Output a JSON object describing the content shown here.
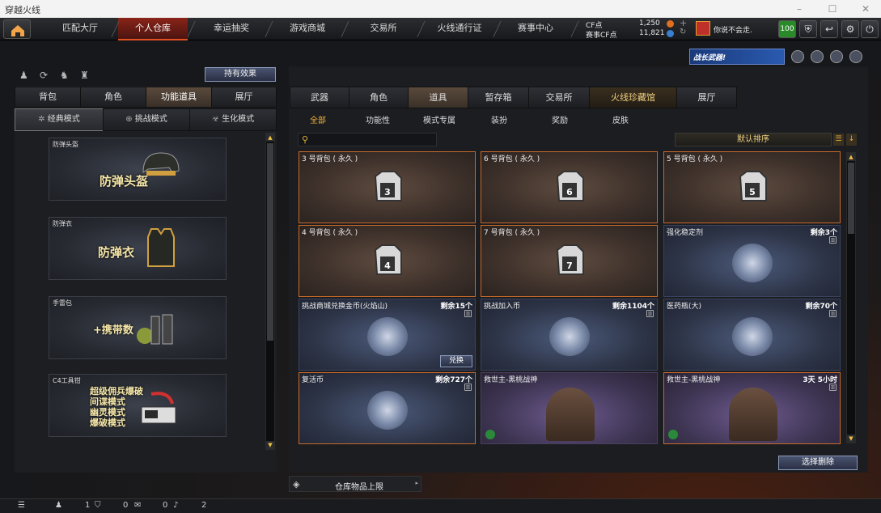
{
  "window": {
    "title": "穿越火线"
  },
  "nav": {
    "tabs": [
      "匹配大厅",
      "个人仓库",
      "幸运抽奖",
      "游戏商城",
      "交易所",
      "火线通行证",
      "赛事中心"
    ],
    "active": 1
  },
  "currency": {
    "cf_label": "CF点",
    "cf_value": "1,250",
    "event_label": "赛事CF点",
    "event_value": "11,821"
  },
  "user": {
    "name": "你说不会走.",
    "level": "100"
  },
  "promo": {
    "text": "战长武器!"
  },
  "left": {
    "effects_button": "持有效果",
    "tabs": [
      "背包",
      "角色",
      "功能道具",
      "展厅"
    ],
    "active_tab": 2,
    "modes": [
      "经典模式",
      "挑战模式",
      "生化模式"
    ],
    "active_mode": 0,
    "slots": [
      {
        "label": "防弹头盔",
        "big": "防弹头盔"
      },
      {
        "label": "防弹衣",
        "big": "防弹衣"
      },
      {
        "label": "手雷包",
        "big": "+携带数"
      },
      {
        "label": "C4工具钳",
        "lines": [
          "超级佣兵爆破",
          "间谍模式",
          "幽灵模式",
          "爆破模式"
        ]
      }
    ]
  },
  "right": {
    "tabs": [
      "武器",
      "角色",
      "道具",
      "暂存箱",
      "交易所",
      "火线珍藏馆",
      "展厅"
    ],
    "active_tab": 2,
    "categories": [
      "全部",
      "功能性",
      "模式专属",
      "装扮",
      "奖励",
      "皮肤"
    ],
    "active_category": 0,
    "search_placeholder": "",
    "sort_label": "默认排序",
    "items": [
      {
        "name": "3 号背包 ( 永久 )",
        "remain": "",
        "bag": "3",
        "style": "brown"
      },
      {
        "name": "6 号背包 ( 永久 )",
        "remain": "",
        "bag": "6",
        "style": "brown"
      },
      {
        "name": "5 号背包 ( 永久 )",
        "remain": "",
        "bag": "5",
        "style": "brown"
      },
      {
        "name": "4 号背包 ( 永久 )",
        "remain": "",
        "bag": "4",
        "style": "brown"
      },
      {
        "name": "7 号背包 ( 永久 )",
        "remain": "",
        "bag": "7",
        "style": "brown"
      },
      {
        "name": "强化稳定剂",
        "remain": "剩余3个",
        "style": "blue"
      },
      {
        "name": "挑战商城兑换金币(火焰山)",
        "remain": "剩余15个",
        "style": "blue",
        "button": "兑换"
      },
      {
        "name": "挑战加入币",
        "remain": "剩余1104个",
        "style": "blue"
      },
      {
        "name": "医药瓶(大)",
        "remain": "剩余70个",
        "style": "blue"
      },
      {
        "name": "复活币",
        "remain": "剩余727个",
        "style": "blue"
      },
      {
        "name": "救世主-黑桃战神",
        "remain": "",
        "style": "purple"
      },
      {
        "name": "救世主-黑桃战神",
        "remain": "3天 5小时",
        "style": "purple"
      }
    ],
    "batch_delete": "选择删除",
    "capacity_label": "仓库物品上限"
  },
  "status": {
    "v1": "1",
    "v2": "0",
    "v3": "0",
    "v4": "2"
  }
}
